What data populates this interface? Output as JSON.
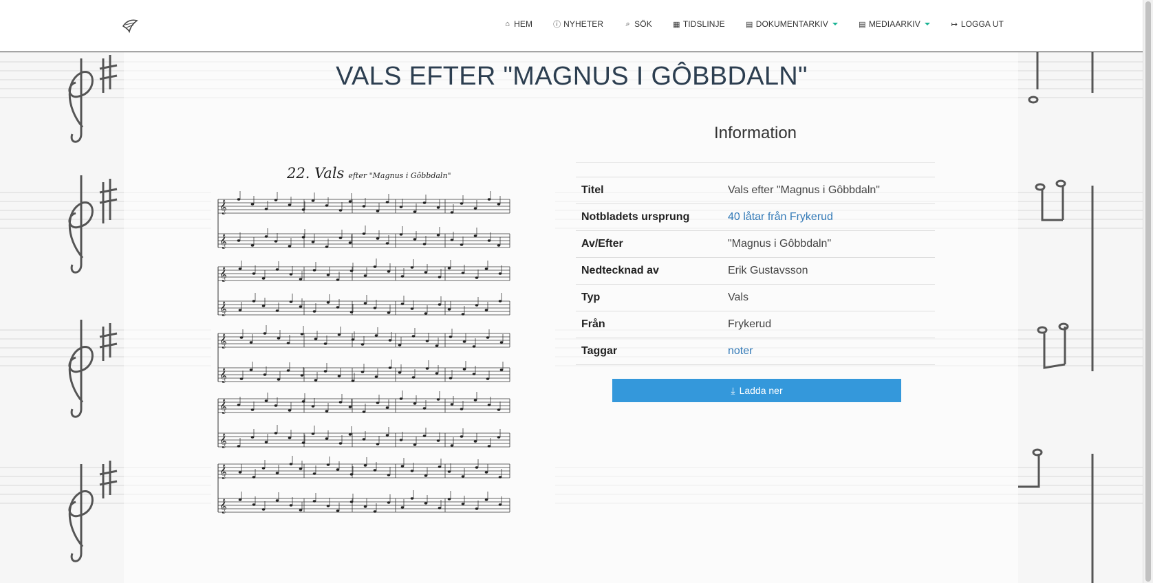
{
  "nav": {
    "items": [
      {
        "icon": "home-icon",
        "glyph": "⌂",
        "label": "HEM",
        "dropdown": false
      },
      {
        "icon": "info-icon",
        "glyph": "ⓘ",
        "label": "NYHETER",
        "dropdown": false
      },
      {
        "icon": "search-icon",
        "glyph": "⌕",
        "label": "SÖK",
        "dropdown": false
      },
      {
        "icon": "calendar-icon",
        "glyph": "▦",
        "label": "TIDSLINJE",
        "dropdown": false
      },
      {
        "icon": "document-icon",
        "glyph": "▤",
        "label": "DOKUMENTARKIV",
        "dropdown": true
      },
      {
        "icon": "document-icon",
        "glyph": "▤",
        "label": "MEDIAARKIV",
        "dropdown": true
      },
      {
        "icon": "logout-icon",
        "glyph": "↦",
        "label": "LOGGA UT",
        "dropdown": false
      }
    ]
  },
  "page": {
    "title": "VALS EFTER \"MAGNUS I GÔBBDALN\""
  },
  "sheet": {
    "number_title": "22. Vals",
    "subtitle": "efter \"Magnus i Gôbbdaln\""
  },
  "info": {
    "heading": "Information",
    "rows": [
      {
        "key": "Titel",
        "value": "Vals efter \"Magnus i Gôbbdaln\"",
        "link": false
      },
      {
        "key": "Notbladets ursprung",
        "value": "40 låtar från Frykerud",
        "link": true
      },
      {
        "key": "Av/Efter",
        "value": "\"Magnus i Gôbbdaln\"",
        "link": false
      },
      {
        "key": "Nedtecknad av",
        "value": "Erik Gustavsson",
        "link": false
      },
      {
        "key": "Typ",
        "value": "Vals",
        "link": false
      },
      {
        "key": "Från",
        "value": "Frykerud",
        "link": false
      },
      {
        "key": "Taggar",
        "value": "noter",
        "link": true
      }
    ]
  },
  "download": {
    "label": "Ladda ner",
    "icon": "download-icon",
    "glyph": "⤓"
  },
  "colors": {
    "title": "#2c3e50",
    "link": "#337ab7",
    "button": "#3498db",
    "caret": "#1ab394"
  }
}
